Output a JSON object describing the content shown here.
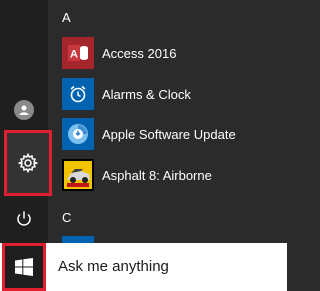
{
  "start_menu": {
    "sections": [
      {
        "letter": "A",
        "apps": [
          {
            "label": "Access 2016",
            "icon": "access-icon",
            "color": "#a4262c"
          },
          {
            "label": "Alarms & Clock",
            "icon": "alarm-clock-icon",
            "color": "#0063b1"
          },
          {
            "label": "Apple Software Update",
            "icon": "apple-update-icon",
            "color": "#0063b1"
          },
          {
            "label": "Asphalt 8: Airborne",
            "icon": "asphalt-icon",
            "color": "#000000"
          }
        ]
      },
      {
        "letter": "C",
        "apps": []
      }
    ],
    "left_rail": {
      "items": [
        "user-icon",
        "gear-icon",
        "power-icon"
      ]
    }
  },
  "taskbar": {
    "search_placeholder": "Ask me anything",
    "start_icon": "windows-logo-icon"
  },
  "highlight_color": "#e0202f"
}
